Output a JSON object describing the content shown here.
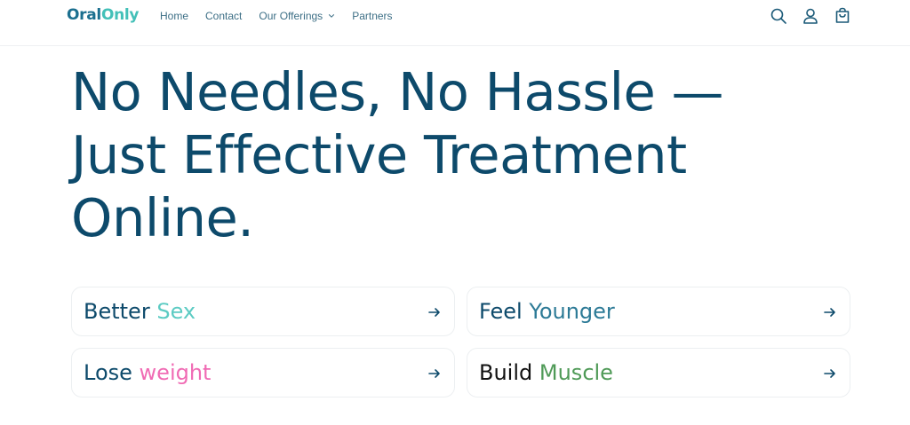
{
  "header": {
    "logo": {
      "part1": "Oral",
      "part2": "Only"
    },
    "nav": [
      {
        "label": "Home"
      },
      {
        "label": "Contact"
      },
      {
        "label": "Our Offerings"
      },
      {
        "label": "Partners"
      }
    ],
    "icons": [
      "search-icon",
      "account-icon",
      "cart-icon"
    ]
  },
  "hero": {
    "line1": "No Needles, No Hassle —",
    "line2": "Just Effective Treatment",
    "line3": "Online."
  },
  "cards": [
    {
      "first": "Better",
      "second": "Sex",
      "first_color": "#0d4a6b",
      "second_color": "#5ccbc3"
    },
    {
      "first": "Feel",
      "second": "Younger",
      "first_color": "#0d4a6b",
      "second_color": "#2c7a96"
    },
    {
      "first": "Lose",
      "second": "weight",
      "first_color": "#0d4a6b",
      "second_color": "#f06bb4"
    },
    {
      "first": "Build",
      "second": "Muscle",
      "first_color": "#111111",
      "second_color": "#4f9a57"
    }
  ],
  "colors": {
    "primary": "#0d4a6b",
    "accent": "#43c0b8",
    "nav_text": "#3d6f86"
  }
}
